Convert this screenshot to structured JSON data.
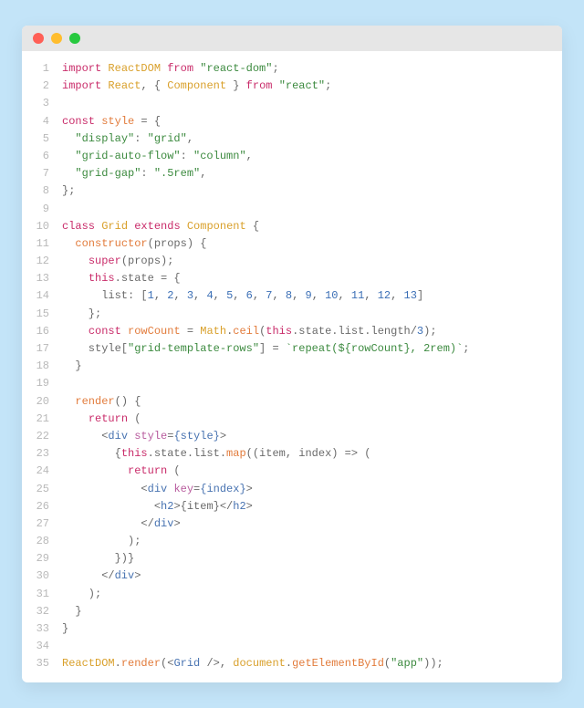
{
  "lines": [
    [
      [
        "kw",
        "import"
      ],
      [
        "punc",
        " "
      ],
      [
        "class",
        "ReactDOM"
      ],
      [
        "punc",
        " "
      ],
      [
        "kw",
        "from"
      ],
      [
        "punc",
        " "
      ],
      [
        "str",
        "\"react-dom\""
      ],
      [
        "punc",
        ";"
      ]
    ],
    [
      [
        "kw",
        "import"
      ],
      [
        "punc",
        " "
      ],
      [
        "class",
        "React"
      ],
      [
        "punc",
        ", { "
      ],
      [
        "class",
        "Component"
      ],
      [
        "punc",
        " } "
      ],
      [
        "kw",
        "from"
      ],
      [
        "punc",
        " "
      ],
      [
        "str",
        "\"react\""
      ],
      [
        "punc",
        ";"
      ]
    ],
    [
      [
        "punc",
        ""
      ]
    ],
    [
      [
        "kw",
        "const"
      ],
      [
        "punc",
        " "
      ],
      [
        "fn",
        "style"
      ],
      [
        "punc",
        " = {"
      ]
    ],
    [
      [
        "punc",
        "  "
      ],
      [
        "str",
        "\"display\""
      ],
      [
        "punc",
        ": "
      ],
      [
        "str",
        "\"grid\""
      ],
      [
        "punc",
        ","
      ]
    ],
    [
      [
        "punc",
        "  "
      ],
      [
        "str",
        "\"grid-auto-flow\""
      ],
      [
        "punc",
        ": "
      ],
      [
        "str",
        "\"column\""
      ],
      [
        "punc",
        ","
      ]
    ],
    [
      [
        "punc",
        "  "
      ],
      [
        "str",
        "\"grid-gap\""
      ],
      [
        "punc",
        ": "
      ],
      [
        "str",
        "\".5rem\""
      ],
      [
        "punc",
        ","
      ]
    ],
    [
      [
        "punc",
        "};"
      ]
    ],
    [
      [
        "punc",
        ""
      ]
    ],
    [
      [
        "kw",
        "class"
      ],
      [
        "punc",
        " "
      ],
      [
        "class",
        "Grid"
      ],
      [
        "punc",
        " "
      ],
      [
        "kw",
        "extends"
      ],
      [
        "punc",
        " "
      ],
      [
        "class",
        "Component"
      ],
      [
        "punc",
        " {"
      ]
    ],
    [
      [
        "punc",
        "  "
      ],
      [
        "fn",
        "constructor"
      ],
      [
        "punc",
        "(props) {"
      ]
    ],
    [
      [
        "punc",
        "    "
      ],
      [
        "kw",
        "super"
      ],
      [
        "punc",
        "(props);"
      ]
    ],
    [
      [
        "punc",
        "    "
      ],
      [
        "kw",
        "this"
      ],
      [
        "punc",
        ".state = {"
      ]
    ],
    [
      [
        "punc",
        "      list: ["
      ],
      [
        "num",
        "1"
      ],
      [
        "punc",
        ", "
      ],
      [
        "num",
        "2"
      ],
      [
        "punc",
        ", "
      ],
      [
        "num",
        "3"
      ],
      [
        "punc",
        ", "
      ],
      [
        "num",
        "4"
      ],
      [
        "punc",
        ", "
      ],
      [
        "num",
        "5"
      ],
      [
        "punc",
        ", "
      ],
      [
        "num",
        "6"
      ],
      [
        "punc",
        ", "
      ],
      [
        "num",
        "7"
      ],
      [
        "punc",
        ", "
      ],
      [
        "num",
        "8"
      ],
      [
        "punc",
        ", "
      ],
      [
        "num",
        "9"
      ],
      [
        "punc",
        ", "
      ],
      [
        "num",
        "10"
      ],
      [
        "punc",
        ", "
      ],
      [
        "num",
        "11"
      ],
      [
        "punc",
        ", "
      ],
      [
        "num",
        "12"
      ],
      [
        "punc",
        ", "
      ],
      [
        "num",
        "13"
      ],
      [
        "punc",
        "]"
      ]
    ],
    [
      [
        "punc",
        "    };"
      ]
    ],
    [
      [
        "punc",
        "    "
      ],
      [
        "kw",
        "const"
      ],
      [
        "punc",
        " "
      ],
      [
        "fn",
        "rowCount"
      ],
      [
        "punc",
        " = "
      ],
      [
        "class",
        "Math"
      ],
      [
        "punc",
        "."
      ],
      [
        "fn",
        "ceil"
      ],
      [
        "punc",
        "("
      ],
      [
        "kw",
        "this"
      ],
      [
        "punc",
        ".state.list.length/"
      ],
      [
        "num",
        "3"
      ],
      [
        "punc",
        ");"
      ]
    ],
    [
      [
        "punc",
        "    style["
      ],
      [
        "str",
        "\"grid-template-rows\""
      ],
      [
        "punc",
        "] = "
      ],
      [
        "str",
        "`repeat(${rowCount}, 2rem)`"
      ],
      [
        "punc",
        ";"
      ]
    ],
    [
      [
        "punc",
        "  }"
      ]
    ],
    [
      [
        "punc",
        ""
      ]
    ],
    [
      [
        "punc",
        "  "
      ],
      [
        "fn",
        "render"
      ],
      [
        "punc",
        "() {"
      ]
    ],
    [
      [
        "punc",
        "    "
      ],
      [
        "kw",
        "return"
      ],
      [
        "punc",
        " ("
      ]
    ],
    [
      [
        "punc",
        "      <"
      ],
      [
        "tag",
        "div"
      ],
      [
        "punc",
        " "
      ],
      [
        "attr",
        "style"
      ],
      [
        "punc",
        "="
      ],
      [
        "tag",
        "{style}"
      ],
      [
        "punc",
        ">"
      ]
    ],
    [
      [
        "punc",
        "        {"
      ],
      [
        "kw",
        "this"
      ],
      [
        "punc",
        ".state.list."
      ],
      [
        "fn",
        "map"
      ],
      [
        "punc",
        "((item, index) => ("
      ]
    ],
    [
      [
        "punc",
        "          "
      ],
      [
        "kw",
        "return"
      ],
      [
        "punc",
        " ("
      ]
    ],
    [
      [
        "punc",
        "            <"
      ],
      [
        "tag",
        "div"
      ],
      [
        "punc",
        " "
      ],
      [
        "attr",
        "key"
      ],
      [
        "punc",
        "="
      ],
      [
        "tag",
        "{index}"
      ],
      [
        "punc",
        ">"
      ]
    ],
    [
      [
        "punc",
        "              <"
      ],
      [
        "tag",
        "h2"
      ],
      [
        "punc",
        ">{item}</"
      ],
      [
        "tag",
        "h2"
      ],
      [
        "punc",
        ">"
      ]
    ],
    [
      [
        "punc",
        "            </"
      ],
      [
        "tag",
        "div"
      ],
      [
        "punc",
        ">"
      ]
    ],
    [
      [
        "punc",
        "          );"
      ]
    ],
    [
      [
        "punc",
        "        })}"
      ]
    ],
    [
      [
        "punc",
        "      </"
      ],
      [
        "tag",
        "div"
      ],
      [
        "punc",
        ">"
      ]
    ],
    [
      [
        "punc",
        "    );"
      ]
    ],
    [
      [
        "punc",
        "  }"
      ]
    ],
    [
      [
        "punc",
        "}"
      ]
    ],
    [
      [
        "punc",
        ""
      ]
    ],
    [
      [
        "class",
        "ReactDOM"
      ],
      [
        "punc",
        "."
      ],
      [
        "fn",
        "render"
      ],
      [
        "punc",
        "(<"
      ],
      [
        "tag",
        "Grid"
      ],
      [
        "punc",
        " />, "
      ],
      [
        "class",
        "document"
      ],
      [
        "punc",
        "."
      ],
      [
        "fn",
        "getElementById"
      ],
      [
        "punc",
        "("
      ],
      [
        "str",
        "\"app\""
      ],
      [
        "punc",
        "));"
      ]
    ]
  ]
}
